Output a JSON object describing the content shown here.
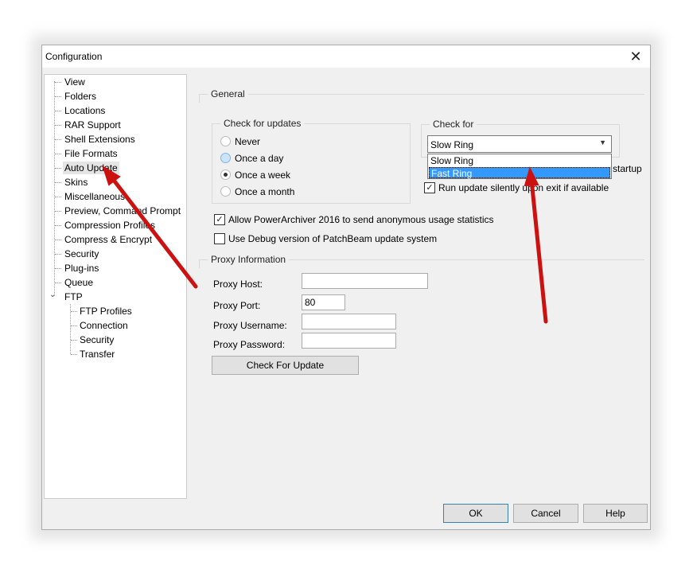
{
  "window": {
    "title": "Configuration",
    "close_glyph": "✕"
  },
  "tree": {
    "items": [
      "View",
      "Folders",
      "Locations",
      "RAR Support",
      "Shell Extensions",
      "File Formats",
      "Auto Update",
      "Skins",
      "Miscellaneous",
      "Preview, Command Prompt",
      "Compression Profiles",
      "Compress & Encrypt",
      "Security",
      "Plug-ins",
      "Queue",
      "FTP"
    ],
    "ftp_children": [
      "FTP Profiles",
      "Connection",
      "Security",
      "Transfer"
    ],
    "selected": "Auto Update",
    "expander_glyph": "⌄"
  },
  "general": {
    "title": "General",
    "check_for_updates": {
      "title": "Check for updates",
      "options": [
        "Never",
        "Once a day",
        "Once a week",
        "Once a month"
      ],
      "selected": "Once a week"
    },
    "check_for": {
      "title": "Check for",
      "value": "Slow Ring",
      "options": [
        "Slow Ring",
        "Fast Ring"
      ],
      "highlighted": "Fast Ring",
      "arrow_glyph": "▼"
    },
    "hidden_label_tail": "startup",
    "run_silently": "Run update silently upon exit if available",
    "allow_stats": "Allow PowerArchiver 2016 to send anonymous usage statistics",
    "debug_version": "Use Debug version of PatchBeam update system"
  },
  "proxy": {
    "title": "Proxy Information",
    "host_label": "Proxy Host:",
    "host_value": "",
    "port_label": "Proxy Port:",
    "port_value": "80",
    "username_label": "Proxy Username:",
    "username_value": "",
    "password_label": "Proxy Password:",
    "password_value": ""
  },
  "buttons": {
    "check_for_update": "Check For Update",
    "ok": "OK",
    "cancel": "Cancel",
    "help": "Help"
  },
  "check_glyph": "✓",
  "colors": {
    "highlight": "#3399ff",
    "annotation_arrow": "#cc1111"
  }
}
